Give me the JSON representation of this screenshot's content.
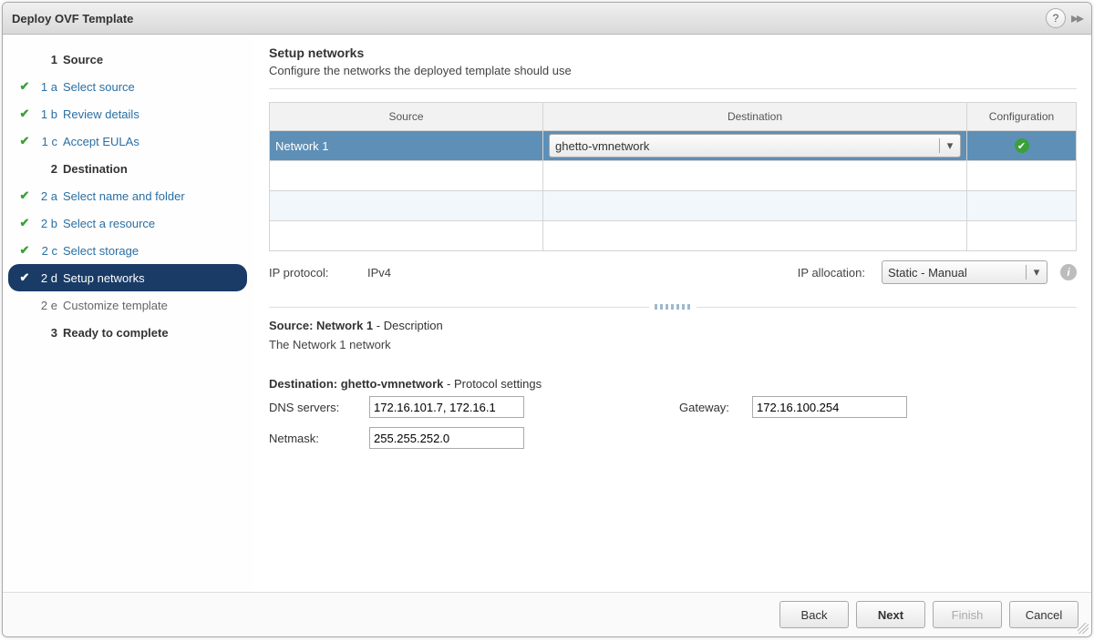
{
  "window": {
    "title": "Deploy OVF Template"
  },
  "sidebar": {
    "g1": {
      "num": "1",
      "label": "Source"
    },
    "s1a": {
      "num": "1 a",
      "label": "Select source"
    },
    "s1b": {
      "num": "1 b",
      "label": "Review details"
    },
    "s1c": {
      "num": "1 c",
      "label": "Accept EULAs"
    },
    "g2": {
      "num": "2",
      "label": "Destination"
    },
    "s2a": {
      "num": "2 a",
      "label": "Select name and folder"
    },
    "s2b": {
      "num": "2 b",
      "label": "Select a resource"
    },
    "s2c": {
      "num": "2 c",
      "label": "Select storage"
    },
    "s2d": {
      "num": "2 d",
      "label": "Setup networks"
    },
    "s2e": {
      "num": "2 e",
      "label": "Customize template"
    },
    "g3": {
      "num": "3",
      "label": "Ready to complete"
    }
  },
  "page": {
    "title": "Setup networks",
    "subtitle": "Configure the networks the deployed template should use"
  },
  "table": {
    "h_source": "Source",
    "h_dest": "Destination",
    "h_config": "Configuration",
    "row1_source": "Network 1",
    "row1_dest": "ghetto-vmnetwork"
  },
  "ip": {
    "protocol_label": "IP protocol:",
    "protocol_value": "IPv4",
    "alloc_label": "IP allocation:",
    "alloc_value": "Static - Manual"
  },
  "src_desc": {
    "heading_prefix": "Source: ",
    "heading_name": "Network 1",
    "heading_suffix": " - Description",
    "text": "The Network 1 network"
  },
  "dst": {
    "heading_prefix": "Destination: ",
    "heading_name": "ghetto-vmnetwork",
    "heading_suffix": " - Protocol settings",
    "dns_label": "DNS servers:",
    "dns_value": "172.16.101.7, 172.16.1",
    "gw_label": "Gateway:",
    "gw_value": "172.16.100.254",
    "nm_label": "Netmask:",
    "nm_value": "255.255.252.0"
  },
  "footer": {
    "back": "Back",
    "next": "Next",
    "finish": "Finish",
    "cancel": "Cancel"
  }
}
